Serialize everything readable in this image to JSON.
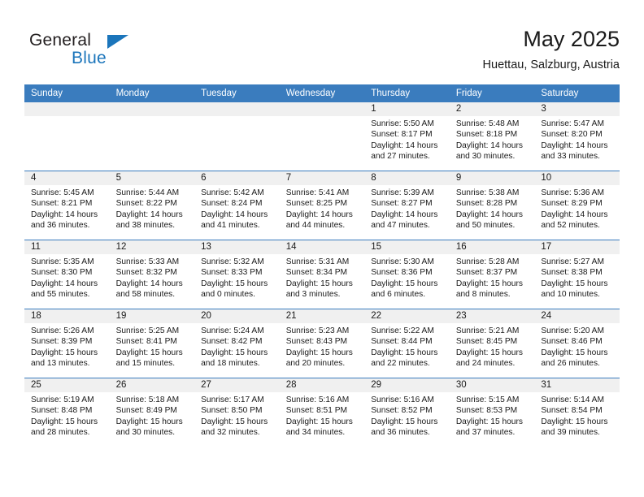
{
  "brand": {
    "line1": "General",
    "line2": "Blue",
    "triangle_icon": "brand-triangle-icon",
    "color_text": "#231f20",
    "color_accent": "#1b75bb"
  },
  "header": {
    "title": "May 2025",
    "subtitle": "Huettau, Salzburg, Austria",
    "header_bg": "#3a7cbe",
    "daynum_bg": "#f0f0f0"
  },
  "weekday_headers": [
    "Sunday",
    "Monday",
    "Tuesday",
    "Wednesday",
    "Thursday",
    "Friday",
    "Saturday"
  ],
  "labels": {
    "sunrise_prefix": "Sunrise:",
    "sunset_prefix": "Sunset:",
    "daylight_prefix": "Daylight:"
  },
  "weeks": [
    {
      "days": [
        {
          "num": "",
          "empty": true
        },
        {
          "num": "",
          "empty": true
        },
        {
          "num": "",
          "empty": true
        },
        {
          "num": "",
          "empty": true
        },
        {
          "num": "1",
          "sunrise": "Sunrise: 5:50 AM",
          "sunset": "Sunset: 8:17 PM",
          "daylight1": "Daylight: 14 hours",
          "daylight2": "and 27 minutes."
        },
        {
          "num": "2",
          "sunrise": "Sunrise: 5:48 AM",
          "sunset": "Sunset: 8:18 PM",
          "daylight1": "Daylight: 14 hours",
          "daylight2": "and 30 minutes."
        },
        {
          "num": "3",
          "sunrise": "Sunrise: 5:47 AM",
          "sunset": "Sunset: 8:20 PM",
          "daylight1": "Daylight: 14 hours",
          "daylight2": "and 33 minutes."
        }
      ]
    },
    {
      "days": [
        {
          "num": "4",
          "sunrise": "Sunrise: 5:45 AM",
          "sunset": "Sunset: 8:21 PM",
          "daylight1": "Daylight: 14 hours",
          "daylight2": "and 36 minutes."
        },
        {
          "num": "5",
          "sunrise": "Sunrise: 5:44 AM",
          "sunset": "Sunset: 8:22 PM",
          "daylight1": "Daylight: 14 hours",
          "daylight2": "and 38 minutes."
        },
        {
          "num": "6",
          "sunrise": "Sunrise: 5:42 AM",
          "sunset": "Sunset: 8:24 PM",
          "daylight1": "Daylight: 14 hours",
          "daylight2": "and 41 minutes."
        },
        {
          "num": "7",
          "sunrise": "Sunrise: 5:41 AM",
          "sunset": "Sunset: 8:25 PM",
          "daylight1": "Daylight: 14 hours",
          "daylight2": "and 44 minutes."
        },
        {
          "num": "8",
          "sunrise": "Sunrise: 5:39 AM",
          "sunset": "Sunset: 8:27 PM",
          "daylight1": "Daylight: 14 hours",
          "daylight2": "and 47 minutes."
        },
        {
          "num": "9",
          "sunrise": "Sunrise: 5:38 AM",
          "sunset": "Sunset: 8:28 PM",
          "daylight1": "Daylight: 14 hours",
          "daylight2": "and 50 minutes."
        },
        {
          "num": "10",
          "sunrise": "Sunrise: 5:36 AM",
          "sunset": "Sunset: 8:29 PM",
          "daylight1": "Daylight: 14 hours",
          "daylight2": "and 52 minutes."
        }
      ]
    },
    {
      "days": [
        {
          "num": "11",
          "sunrise": "Sunrise: 5:35 AM",
          "sunset": "Sunset: 8:30 PM",
          "daylight1": "Daylight: 14 hours",
          "daylight2": "and 55 minutes."
        },
        {
          "num": "12",
          "sunrise": "Sunrise: 5:33 AM",
          "sunset": "Sunset: 8:32 PM",
          "daylight1": "Daylight: 14 hours",
          "daylight2": "and 58 minutes."
        },
        {
          "num": "13",
          "sunrise": "Sunrise: 5:32 AM",
          "sunset": "Sunset: 8:33 PM",
          "daylight1": "Daylight: 15 hours",
          "daylight2": "and 0 minutes."
        },
        {
          "num": "14",
          "sunrise": "Sunrise: 5:31 AM",
          "sunset": "Sunset: 8:34 PM",
          "daylight1": "Daylight: 15 hours",
          "daylight2": "and 3 minutes."
        },
        {
          "num": "15",
          "sunrise": "Sunrise: 5:30 AM",
          "sunset": "Sunset: 8:36 PM",
          "daylight1": "Daylight: 15 hours",
          "daylight2": "and 6 minutes."
        },
        {
          "num": "16",
          "sunrise": "Sunrise: 5:28 AM",
          "sunset": "Sunset: 8:37 PM",
          "daylight1": "Daylight: 15 hours",
          "daylight2": "and 8 minutes."
        },
        {
          "num": "17",
          "sunrise": "Sunrise: 5:27 AM",
          "sunset": "Sunset: 8:38 PM",
          "daylight1": "Daylight: 15 hours",
          "daylight2": "and 10 minutes."
        }
      ]
    },
    {
      "days": [
        {
          "num": "18",
          "sunrise": "Sunrise: 5:26 AM",
          "sunset": "Sunset: 8:39 PM",
          "daylight1": "Daylight: 15 hours",
          "daylight2": "and 13 minutes."
        },
        {
          "num": "19",
          "sunrise": "Sunrise: 5:25 AM",
          "sunset": "Sunset: 8:41 PM",
          "daylight1": "Daylight: 15 hours",
          "daylight2": "and 15 minutes."
        },
        {
          "num": "20",
          "sunrise": "Sunrise: 5:24 AM",
          "sunset": "Sunset: 8:42 PM",
          "daylight1": "Daylight: 15 hours",
          "daylight2": "and 18 minutes."
        },
        {
          "num": "21",
          "sunrise": "Sunrise: 5:23 AM",
          "sunset": "Sunset: 8:43 PM",
          "daylight1": "Daylight: 15 hours",
          "daylight2": "and 20 minutes."
        },
        {
          "num": "22",
          "sunrise": "Sunrise: 5:22 AM",
          "sunset": "Sunset: 8:44 PM",
          "daylight1": "Daylight: 15 hours",
          "daylight2": "and 22 minutes."
        },
        {
          "num": "23",
          "sunrise": "Sunrise: 5:21 AM",
          "sunset": "Sunset: 8:45 PM",
          "daylight1": "Daylight: 15 hours",
          "daylight2": "and 24 minutes."
        },
        {
          "num": "24",
          "sunrise": "Sunrise: 5:20 AM",
          "sunset": "Sunset: 8:46 PM",
          "daylight1": "Daylight: 15 hours",
          "daylight2": "and 26 minutes."
        }
      ]
    },
    {
      "days": [
        {
          "num": "25",
          "sunrise": "Sunrise: 5:19 AM",
          "sunset": "Sunset: 8:48 PM",
          "daylight1": "Daylight: 15 hours",
          "daylight2": "and 28 minutes."
        },
        {
          "num": "26",
          "sunrise": "Sunrise: 5:18 AM",
          "sunset": "Sunset: 8:49 PM",
          "daylight1": "Daylight: 15 hours",
          "daylight2": "and 30 minutes."
        },
        {
          "num": "27",
          "sunrise": "Sunrise: 5:17 AM",
          "sunset": "Sunset: 8:50 PM",
          "daylight1": "Daylight: 15 hours",
          "daylight2": "and 32 minutes."
        },
        {
          "num": "28",
          "sunrise": "Sunrise: 5:16 AM",
          "sunset": "Sunset: 8:51 PM",
          "daylight1": "Daylight: 15 hours",
          "daylight2": "and 34 minutes."
        },
        {
          "num": "29",
          "sunrise": "Sunrise: 5:16 AM",
          "sunset": "Sunset: 8:52 PM",
          "daylight1": "Daylight: 15 hours",
          "daylight2": "and 36 minutes."
        },
        {
          "num": "30",
          "sunrise": "Sunrise: 5:15 AM",
          "sunset": "Sunset: 8:53 PM",
          "daylight1": "Daylight: 15 hours",
          "daylight2": "and 37 minutes."
        },
        {
          "num": "31",
          "sunrise": "Sunrise: 5:14 AM",
          "sunset": "Sunset: 8:54 PM",
          "daylight1": "Daylight: 15 hours",
          "daylight2": "and 39 minutes."
        }
      ]
    }
  ]
}
